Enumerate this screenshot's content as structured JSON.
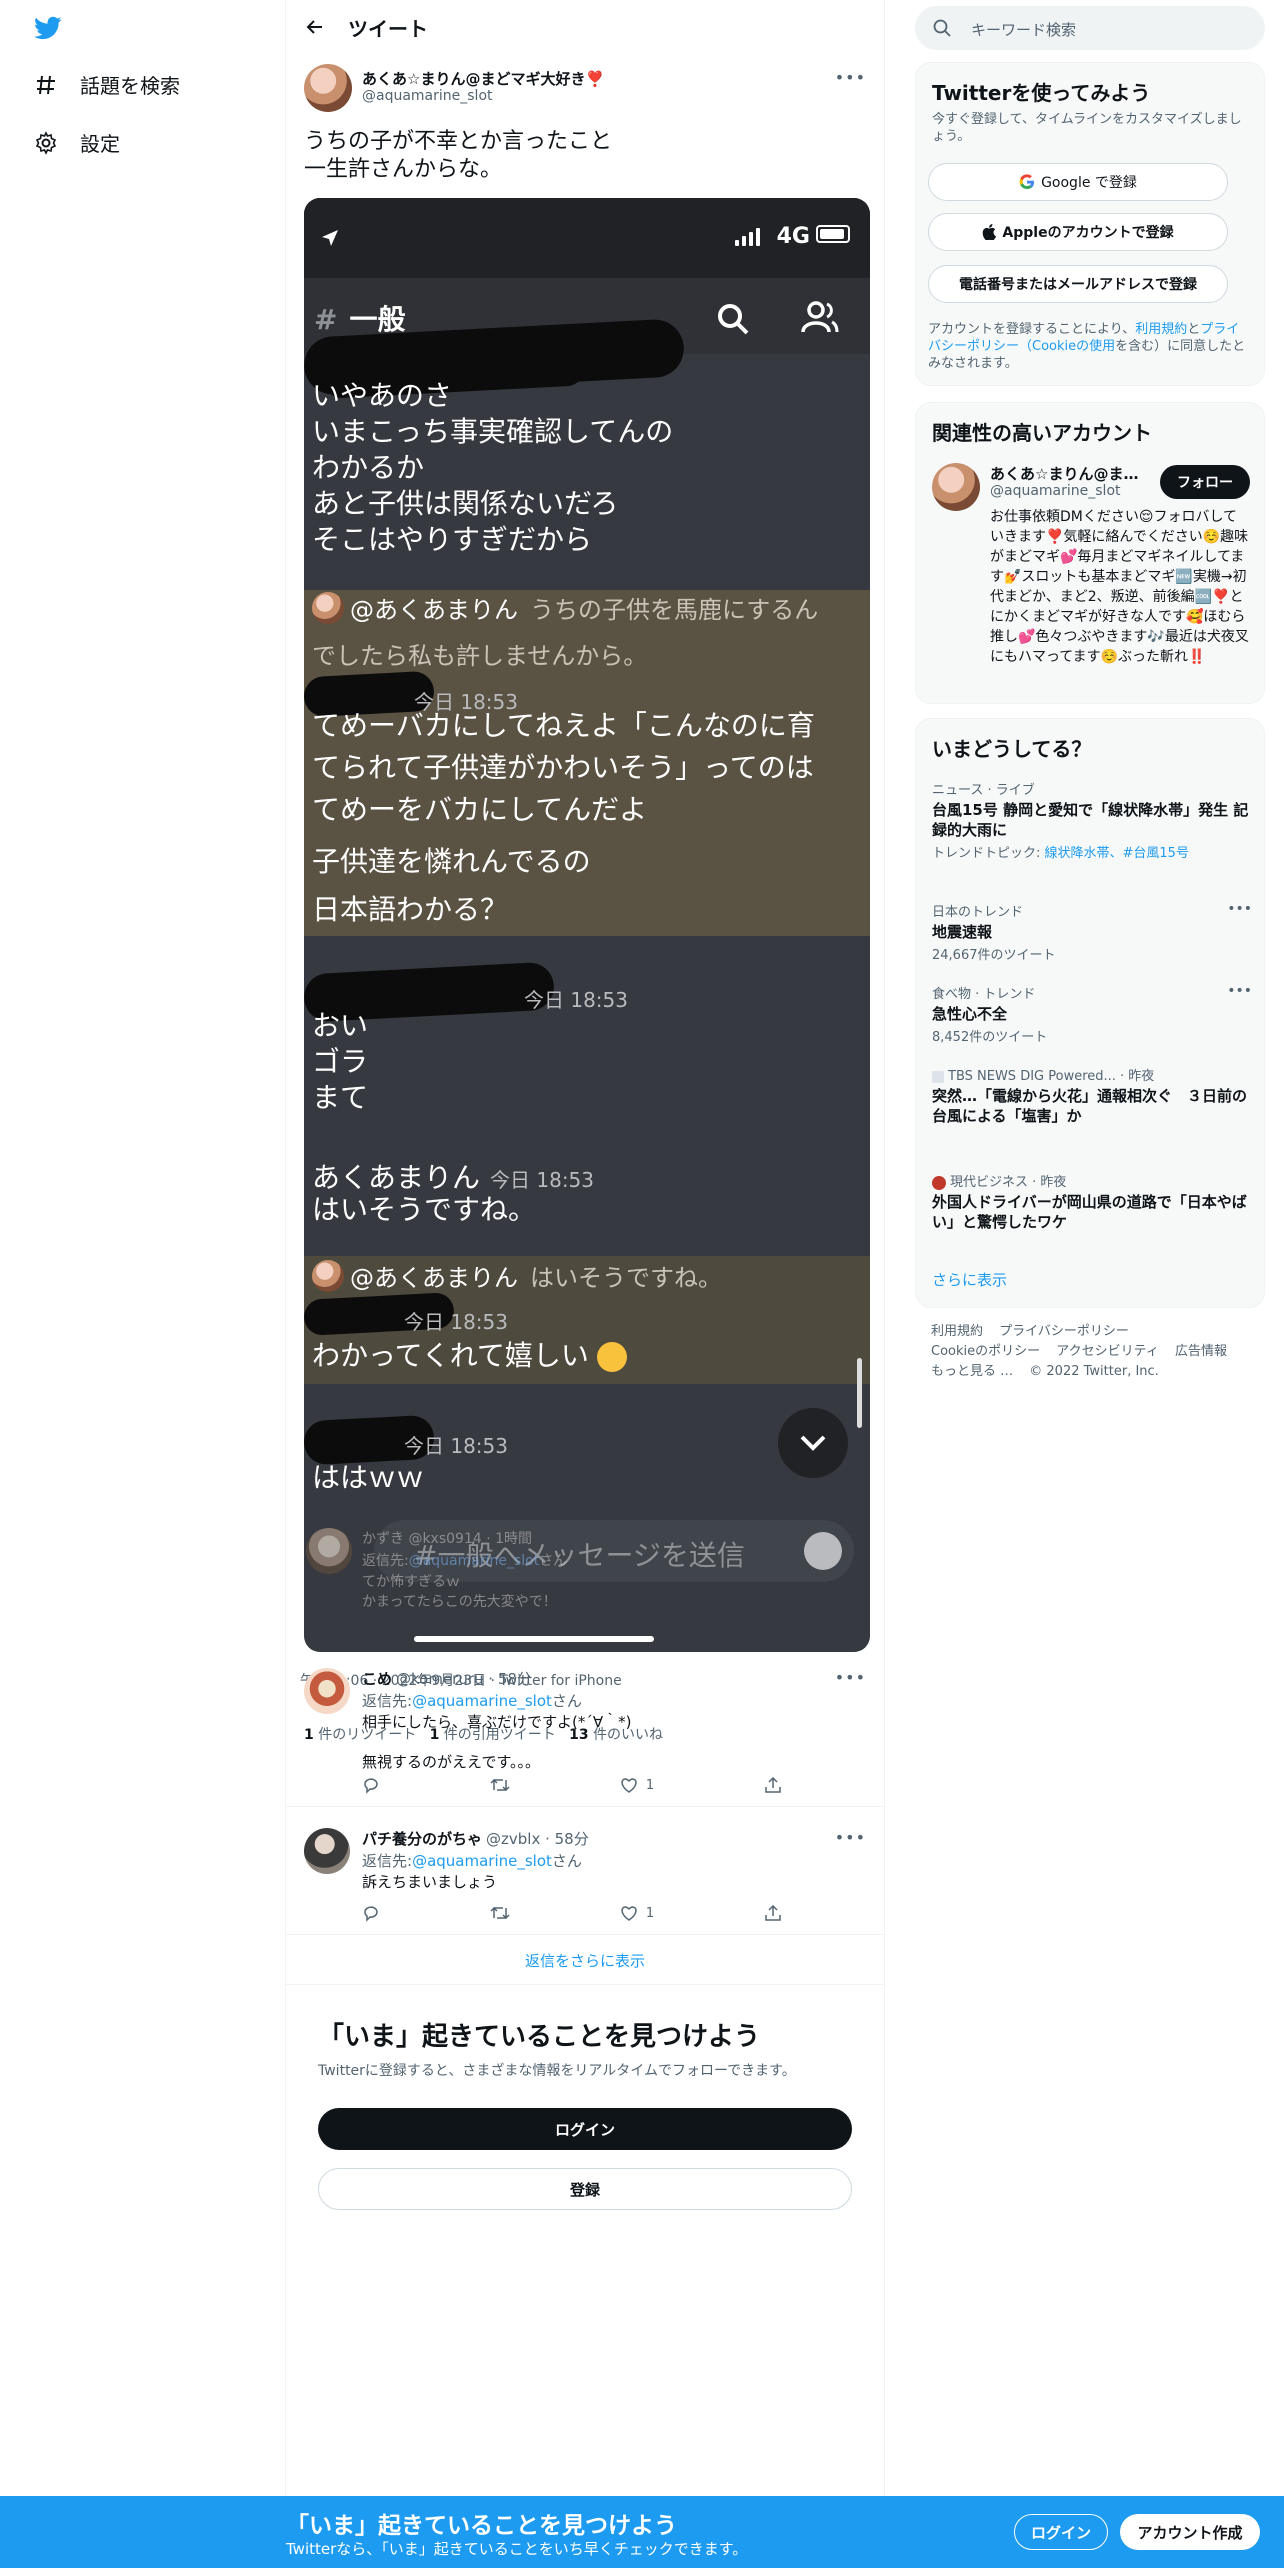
{
  "nav": {
    "items": [
      {
        "label": "話題を検索",
        "icon": "hashtag-icon"
      },
      {
        "label": "設定",
        "icon": "gear-icon"
      }
    ]
  },
  "header": {
    "title": "ツイート"
  },
  "tweet": {
    "display_name": "あくあ☆まりん@まどマギ大好き❣️",
    "username": "@aquamarine_slot",
    "text": "うちの子が不幸とか言ったこと\n一生許さんからな。",
    "timestamp": "午後10:06 · 2022年9月23日 · Twitter for iPhone",
    "retweets": "1",
    "retweets_label": "件のリツイート",
    "quotes": "1",
    "quotes_label": "件の引用ツイート",
    "likes": "13",
    "likes_label": "件のいいね"
  },
  "screenshot": {
    "network": "4G",
    "channel": "一般",
    "lines_a": [
      "いやあのさ",
      "いまこっち事実確認してんの",
      "わかるか",
      "あと子供は関係ないだろ",
      "そこはやりすぎだから"
    ],
    "reply1_mention": "@あくあまりん",
    "reply1_rest": "うちの子供を馬鹿にするん",
    "reply1_line2": "でしたら私も許しませんから。",
    "stamp_1": "今日 18:53",
    "lines_b": [
      "てめーバカにしてねえよ「こんなのに育",
      "てられて子供達がかわいそう」ってのは",
      "てめーをバカにしてんだよ",
      "子供達を憐れんでるの",
      "日本語わかる？"
    ],
    "stamp_2": "今日 18:53",
    "lines_c": [
      "おい",
      "ゴラ",
      "まて"
    ],
    "author_name": "あくあまりん",
    "author_stamp": "今日 18:53",
    "author_msg": "はいそうですね。",
    "reply2_mention": "@あくあまりん",
    "reply2_rest": "はいそうですね。",
    "stamp_3": "今日 18:53",
    "msg_glad": "わかってくれて嬉しい",
    "stamp_4": "今日 18:53",
    "msg_laugh": "ははｗｗ",
    "input_placeholder": "#一般へメッセージを送信",
    "ghost_name": "かずき",
    "ghost_handle": "@kxs0914 · 1時間",
    "ghost_to_prefix": "返信先:",
    "ghost_to": "@aquamarine_slot",
    "ghost_to_suffix": "さん",
    "ghost_body": "てか怖すぎるｗ\nかまってたらこの先大変やで！"
  },
  "replies": [
    {
      "name": "こめ",
      "handle": "@komeruru · 58分",
      "to_prefix": "返信先:",
      "to": "@aquamarine_slot",
      "to_suffix": "さん",
      "body": "相手にしたら、喜ぶだけですよ(*´∀｀*)\n\n無視するのがええです。。。",
      "likes": "1"
    },
    {
      "name": "パチ養分のがちゃ",
      "handle": "@zvblx · 58分",
      "to_prefix": "返信先:",
      "to": "@aquamarine_slot",
      "to_suffix": "さん",
      "body": "訴えちまいましょう",
      "likes": "1"
    }
  ],
  "more_replies": "返信をさらに表示",
  "discover": {
    "title": "「いま」起きていることを見つけよう",
    "subtitle": "Twitterに登録すると、さまざまな情報をリアルタイムでフォローできます。",
    "login": "ログイン",
    "signup": "登録"
  },
  "search": {
    "placeholder": "キーワード検索"
  },
  "signup_card": {
    "title": "Twitterを使ってみよう",
    "desc": "今すぐ登録して、タイムラインをカスタマイズしましょう。",
    "google": "Google で登録",
    "apple": "Appleのアカウントで登録",
    "phone": "電話番号またはメールアドレスで登録",
    "terms_pre": "アカウントを登録することにより、",
    "terms_link1": "利用規約",
    "terms_mid": "と",
    "terms_link2": "プライバシーポリシー（Cookieの使用",
    "terms_post": "を含む）に同意したとみなされます。"
  },
  "related": {
    "title": "関連性の高いアカウント",
    "name": "あくあ☆まりん@まどマギ大好き❣️",
    "handle": "@aquamarine_slot",
    "follow": "フォロー",
    "bio": "お仕事依頼DMください😌フォロバしていきます❣️気軽に絡んでください☺️趣味がまどマギ💕毎月まどマギネイルしてます💅スロットも基本まどマギ🆕実機→初代まどか、まど2、叛逆、前後編🆒❣️とにかくまどマギが好きな人です🥰ほむら推し💕色々つぶやきます🎶最近は犬夜叉にもハマってます☺️ぶった斬れ‼️"
  },
  "trends": {
    "title": "いまどうしてる？",
    "items": [
      {
        "cat": "ニュース · ライブ",
        "title": "台風15号 静岡と愛知で「線状降水帯」発生 記録的大雨に",
        "note_prefix": "トレンドトピック: ",
        "note_link": "線状降水帯、#台風15号"
      },
      {
        "cat": "日本のトレンド",
        "title": "地震速報",
        "count": "24,667件のツイート"
      },
      {
        "cat": "食べ物 · トレンド",
        "title": "急性心不全",
        "count": "8,452件のツイート"
      },
      {
        "cat": "TBS NEWS DIG Powered... · 昨夜",
        "title": "突然…「電線から火花」通報相次ぐ　３日前の台風による「塩害」か"
      },
      {
        "cat": "現代ビジネス · 昨夜",
        "title": "外国人ドライバーが岡山県の道路で「日本やばい」と驚愕したワケ"
      }
    ],
    "show_more": "さらに表示"
  },
  "footer": {
    "links": [
      "利用規約",
      "プライバシーポリシー",
      "Cookieのポリシー",
      "アクセシビリティ",
      "広告情報",
      "もっと見る …",
      "© 2022 Twitter, Inc."
    ]
  },
  "bottom": {
    "title": "「いま」起きていることを見つけよう",
    "subtitle": "Twitterなら、「いま」起きていることをいち早くチェックできます。",
    "login": "ログイン",
    "signup": "アカウント作成"
  },
  "colors": {
    "accent": "#1d9bf0",
    "discord_bg": "#36393f",
    "highlight": "#5a5242"
  }
}
